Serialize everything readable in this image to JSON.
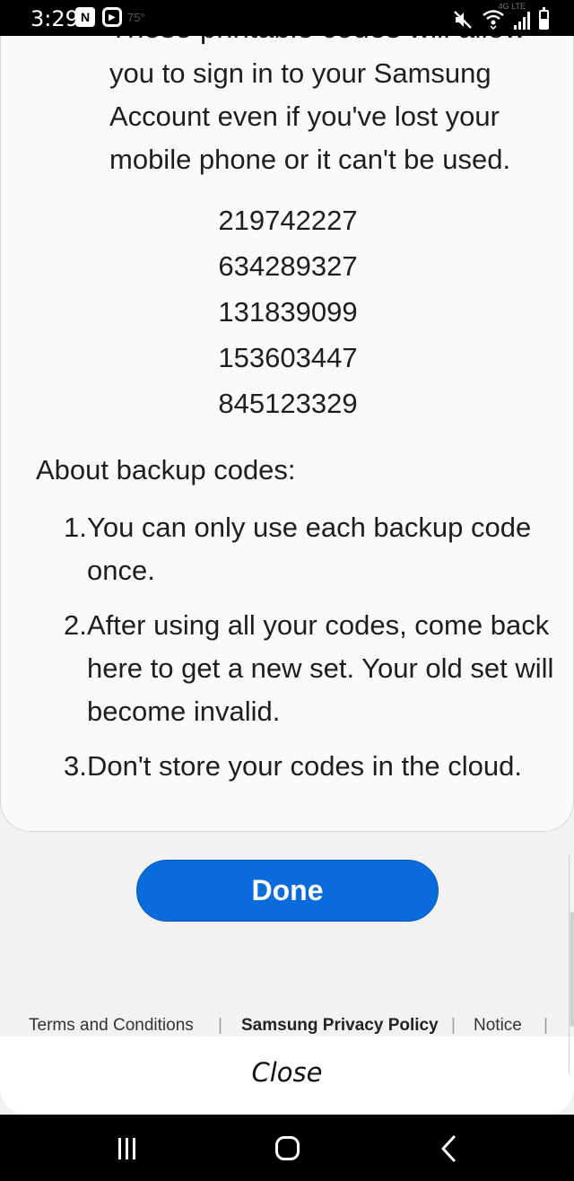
{
  "status_bar": {
    "time": "3:29",
    "left_icons": [
      "n-app-icon",
      "screen-record-icon"
    ],
    "dimmed_text": "75°",
    "lte": "4G LTE",
    "right_icons": [
      "mute-icon",
      "wifi-icon",
      "signal-icon",
      "battery-icon"
    ]
  },
  "content": {
    "clipped_line": "These printable codes will allow",
    "intro_lines": [
      "you to sign in to your Samsung",
      "Account even if you've lost your",
      "mobile phone or it can't be used."
    ],
    "codes": [
      "219742227",
      "634289327",
      "131839099",
      "153603447",
      "845123329"
    ],
    "about_title": "About backup codes:",
    "rules": [
      {
        "num": "1.",
        "text": "You can only use each backup code once."
      },
      {
        "num": "2.",
        "text": "After using all your codes, come back here to get a new set. Your old set will become invalid."
      },
      {
        "num": "3.",
        "text": "Don't store your codes in the cloud."
      }
    ]
  },
  "done_button": {
    "label": "Done",
    "color": "#0a6cdc"
  },
  "footer": {
    "terms": "Terms and Conditions",
    "privacy": "Samsung Privacy Policy",
    "notice": "Notice",
    "separator": "|"
  },
  "close_button": {
    "label": "Close"
  },
  "nav_bar": {
    "icons": [
      "recent-apps-icon",
      "home-icon",
      "back-icon"
    ]
  }
}
